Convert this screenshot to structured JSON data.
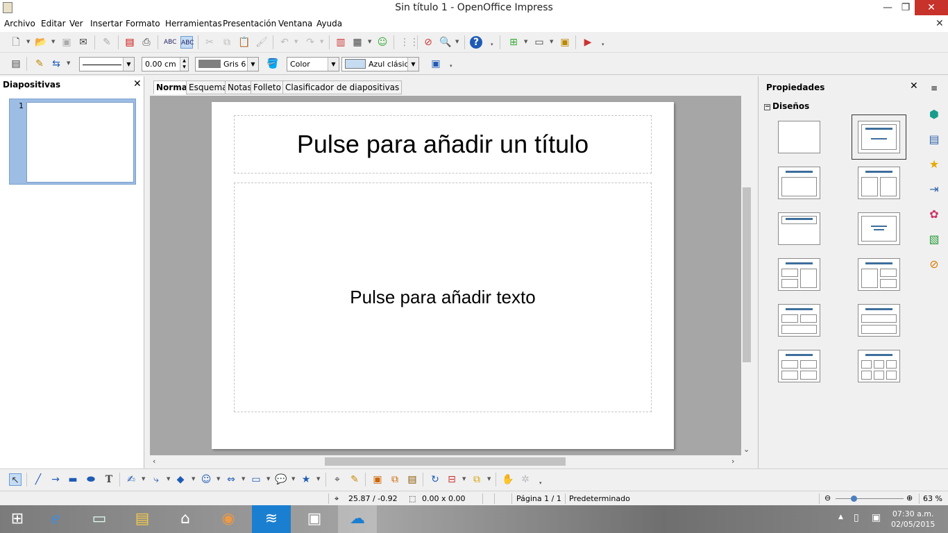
{
  "window": {
    "title": "Sin título 1 - OpenOffice Impress",
    "minimize_glyph": "—",
    "maximize_glyph": "❐",
    "close_glyph": "✕"
  },
  "menu": [
    "Archivo",
    "Editar",
    "Ver",
    "Insertar",
    "Formato",
    "Herramientas",
    "Presentación",
    "Ventana",
    "Ayuda"
  ],
  "line_toolbar": {
    "line_width": "0.00 cm",
    "line_color": "Gris 6",
    "line_color_swatch": "#808080",
    "area_style": "Color",
    "area_fill": "Azul clásico",
    "area_fill_swatch": "#c6dcf0"
  },
  "slides_pane": {
    "title": "Diapositivas",
    "close_glyph": "✕",
    "slides": [
      {
        "number": "1"
      }
    ]
  },
  "view_tabs": [
    "Normal",
    "Esquema",
    "Notas",
    "Folleto",
    "Clasificador de diapositivas"
  ],
  "slide": {
    "title_placeholder": "Pulse para añadir un título",
    "text_placeholder": "Pulse para añadir texto"
  },
  "properties": {
    "title": "Propiedades",
    "close_glyph": "✕",
    "section": "Diseños",
    "collapse_glyph": "−"
  },
  "status": {
    "position": "25.87 / -0.92",
    "size": "0.00 x 0.00",
    "page": "Página 1 / 1",
    "master": "Predeterminado",
    "zoom": "63 %"
  },
  "taskbar": {
    "time": "07:30 a.m.",
    "date": "02/05/2015"
  },
  "icons": {
    "standard": [
      "new-icon",
      "open-icon",
      "save-icon",
      "email-icon",
      "edit-file-icon",
      "export-pdf-icon",
      "print-icon",
      "spellcheck-icon",
      "autospellcheck-icon",
      "cut-icon",
      "copy-icon",
      "paste-icon",
      "format-paintbrush-icon",
      "undo-icon",
      "redo-icon",
      "chart-icon",
      "table-icon",
      "gallery-icon",
      "grid-icon",
      "navigator-icon",
      "zoom-icon",
      "help-icon"
    ],
    "drawing": [
      "select-icon",
      "line-icon",
      "arrow-icon",
      "rectangle-icon",
      "ellipse-icon",
      "text-icon",
      "curve-icon",
      "connector-icon",
      "basic-shapes-icon",
      "symbol-shapes-icon",
      "block-arrows-icon",
      "flowchart-icon",
      "callouts-icon",
      "stars-icon",
      "points-icon",
      "glue-points-icon",
      "fontwork-icon",
      "from-file-icon",
      "gallery-icon",
      "rotate-icon",
      "align-icon",
      "arrange-icon",
      "extrusion-icon"
    ]
  }
}
